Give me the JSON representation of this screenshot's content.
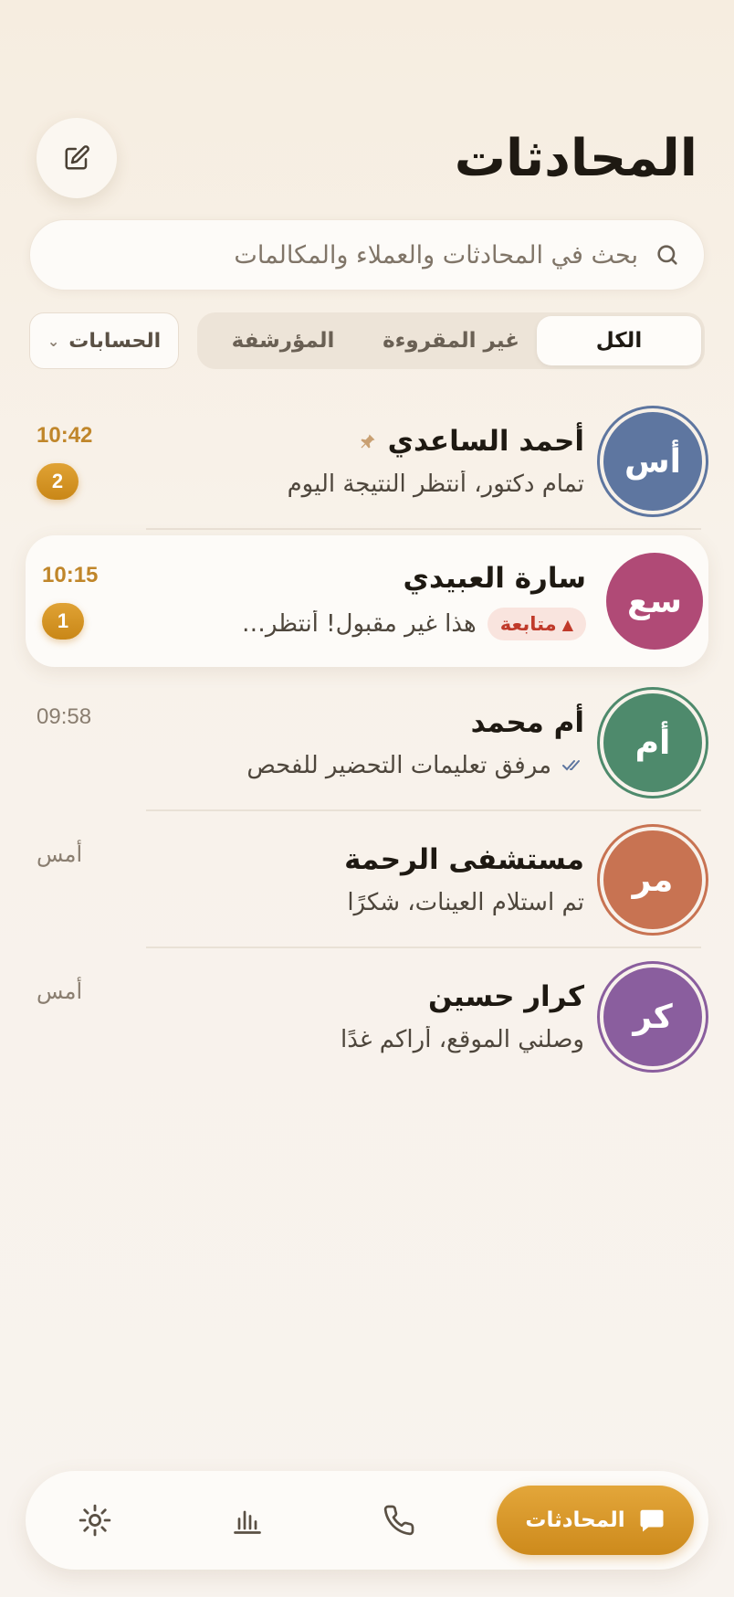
{
  "header": {
    "title": "المحادثات",
    "compose_icon": "edit-icon"
  },
  "search": {
    "placeholder": "بحث في المحادثات والعملاء والمكالمات",
    "icon": "search-icon"
  },
  "filters": {
    "tabs": [
      {
        "label": "الكل",
        "active": true
      },
      {
        "label": "غير المقروءة",
        "active": false
      },
      {
        "label": "المؤرشفة",
        "active": false
      }
    ],
    "accounts_label": "الحسابات",
    "accounts_chevron": "⌄"
  },
  "conversations": [
    {
      "initials": "أس",
      "name": "أحمد الساعدي",
      "preview": "تمام دكتور، أنتظر النتيجة اليوم",
      "time": "10:42",
      "unread": "2",
      "pinned": true,
      "color": "#5e76a0"
    },
    {
      "initials": "سع",
      "name": "سارة العبيدي",
      "preview": "هذا غير مقبول! أنتظر…",
      "time": "10:15",
      "unread": "1",
      "tag": "متابعة",
      "tag_icon": "▲",
      "color": "#b04a76"
    },
    {
      "initials": "أم",
      "name": "أم محمد",
      "preview": "مرفق تعليمات التحضير للفحص",
      "time": "09:58",
      "read_receipt": true,
      "color": "#4e8a6c"
    },
    {
      "initials": "مر",
      "name": "مستشفى الرحمة",
      "preview": "تم استلام العينات، شكرًا",
      "time": "أمس",
      "color": "#c87352"
    },
    {
      "initials": "كر",
      "name": "كرار حسين",
      "preview": "وصلني الموقع، أراكم غدًا",
      "time": "أمس",
      "color": "#8a5e9e"
    }
  ],
  "nav": {
    "active_label": "المحادثات",
    "items": [
      "chat-icon",
      "phone-icon",
      "chart-icon",
      "settings-icon"
    ]
  },
  "colors": {
    "accent": "#d3921f",
    "background": "#f8f2ea",
    "alert": "#c03a2a"
  }
}
